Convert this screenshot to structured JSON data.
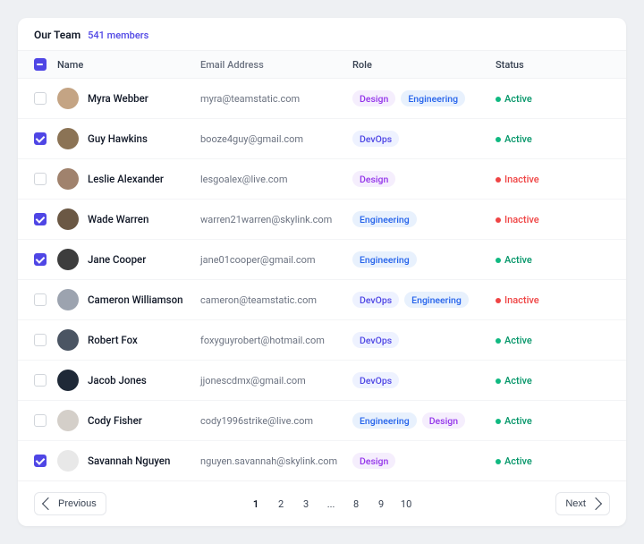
{
  "header": {
    "title": "Our Team",
    "count_badge": "541 members"
  },
  "columns": {
    "name": "Name",
    "email": "Email Address",
    "role": "Role",
    "status": "Status"
  },
  "rows": [
    {
      "name": "Myra Webber",
      "email": "myra@teamstatic.com",
      "roles": [
        "Design",
        "Engineering"
      ],
      "status": "Active",
      "checked": false,
      "avatar_bg": "#c4a484"
    },
    {
      "name": "Guy Hawkins",
      "email": "booze4guy@gmail.com",
      "roles": [
        "DevOps"
      ],
      "status": "Active",
      "checked": true,
      "avatar_bg": "#8b7355"
    },
    {
      "name": "Leslie Alexander",
      "email": "lesgoalex@live.com",
      "roles": [
        "Design"
      ],
      "status": "Inactive",
      "checked": false,
      "avatar_bg": "#a0826d"
    },
    {
      "name": "Wade Warren",
      "email": "warren21warren@skylink.com",
      "roles": [
        "Engineering"
      ],
      "status": "Inactive",
      "checked": true,
      "avatar_bg": "#6b5844"
    },
    {
      "name": "Jane Cooper",
      "email": "jane01cooper@gmail.com",
      "roles": [
        "Engineering"
      ],
      "status": "Active",
      "checked": true,
      "avatar_bg": "#3d3d3d"
    },
    {
      "name": "Cameron Williamson",
      "email": "cameron@teamstatic.com",
      "roles": [
        "DevOps",
        "Engineering"
      ],
      "status": "Inactive",
      "checked": false,
      "avatar_bg": "#9ca3af"
    },
    {
      "name": "Robert Fox",
      "email": "foxyguyrobert@hotmail.com",
      "roles": [
        "DevOps"
      ],
      "status": "Active",
      "checked": false,
      "avatar_bg": "#4b5563"
    },
    {
      "name": "Jacob Jones",
      "email": "jjonescdmx@gmail.com",
      "roles": [
        "DevOps"
      ],
      "status": "Active",
      "checked": false,
      "avatar_bg": "#1f2937"
    },
    {
      "name": "Cody Fisher",
      "email": "cody1996strike@live.com",
      "roles": [
        "Engineering",
        "Design"
      ],
      "status": "Active",
      "checked": false,
      "avatar_bg": "#d4cfc9"
    },
    {
      "name": "Savannah Nguyen",
      "email": "nguyen.savannah@skylink.com",
      "roles": [
        "Design"
      ],
      "status": "Active",
      "checked": true,
      "avatar_bg": "#e8e8e8"
    }
  ],
  "pagination": {
    "prev": "Previous",
    "next": "Next",
    "pages": [
      "1",
      "2",
      "3",
      "...",
      "8",
      "9",
      "10"
    ],
    "current": "1"
  }
}
